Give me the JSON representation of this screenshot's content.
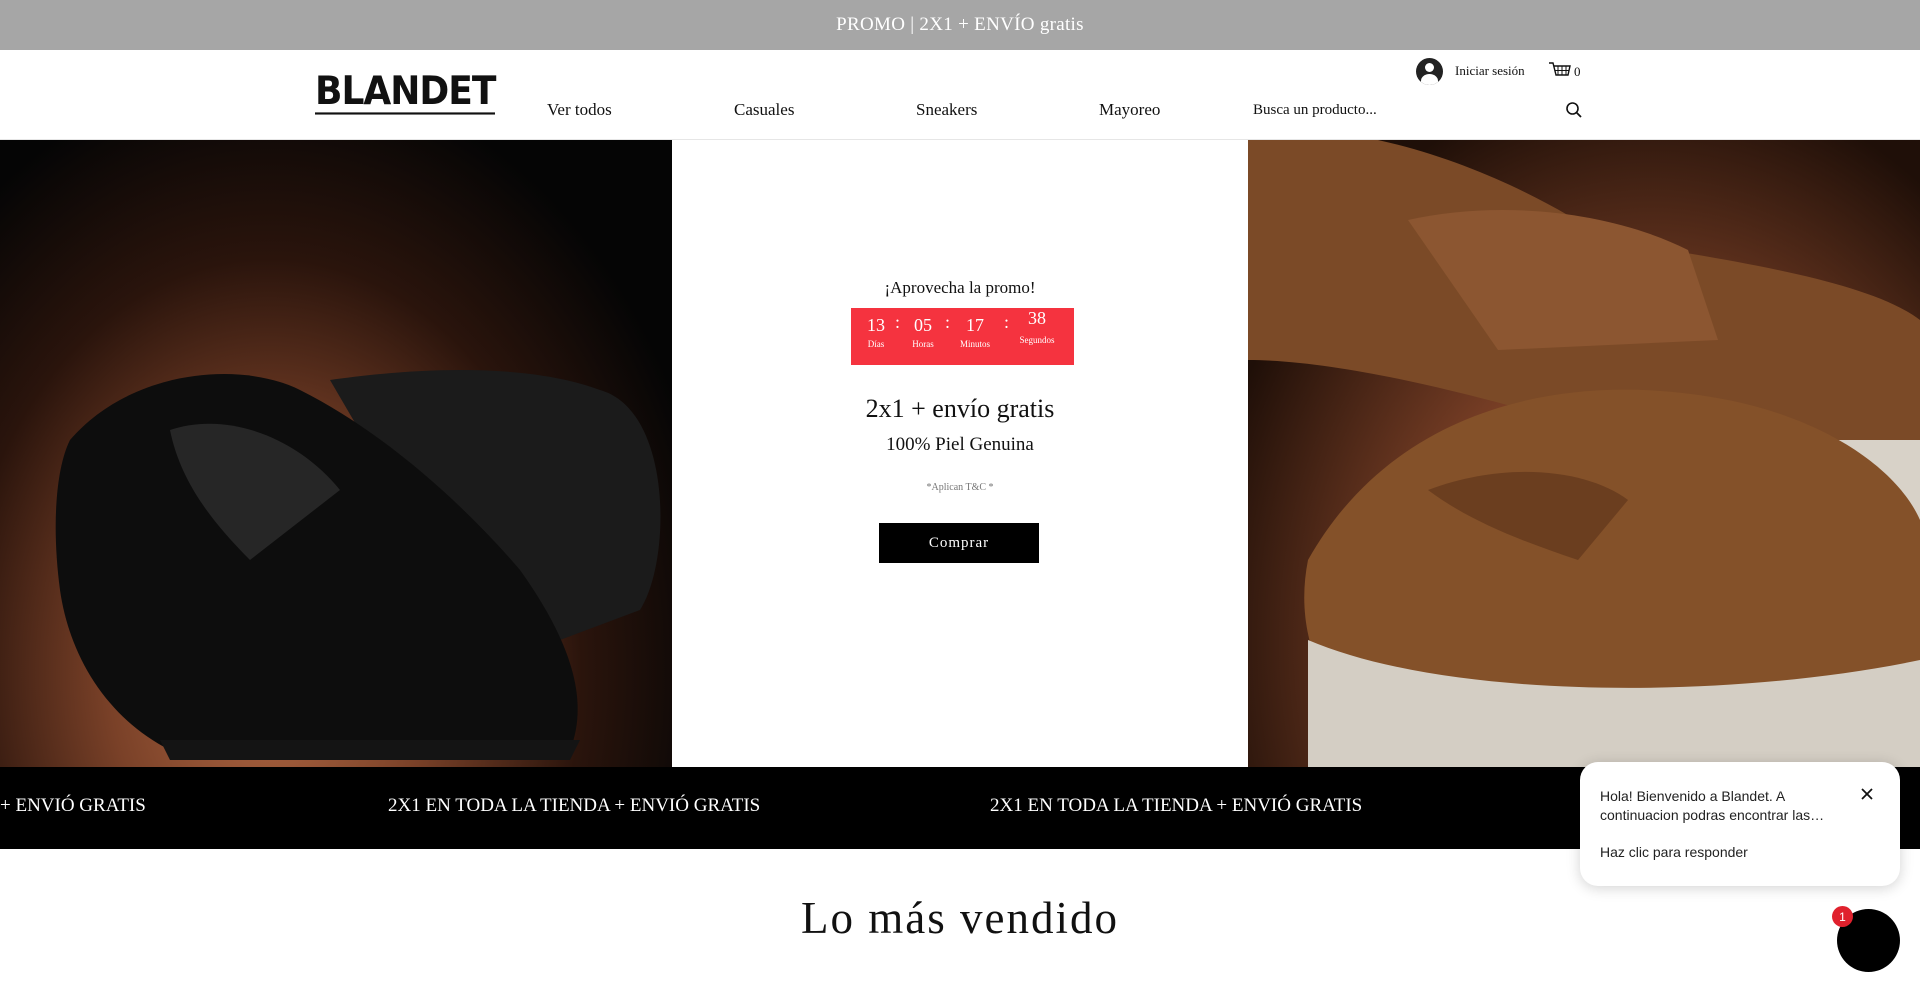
{
  "promo_bar": {
    "text": "PROMO | 2X1 + ENVÍO  gratis"
  },
  "header": {
    "logo": "BLANDET",
    "nav": [
      "Ver todos",
      "Casuales",
      "Sneakers",
      "Mayoreo"
    ],
    "search_placeholder": "Busca un producto...",
    "login_label": "Iniciar sesión",
    "cart_count": "0"
  },
  "hero": {
    "heading": "¡Aprovecha la promo!",
    "countdown": {
      "days": "13",
      "days_label": "Días",
      "hours": "05",
      "hours_label": "Horas",
      "minutes": "17",
      "minutes_label": "Minutos",
      "seconds": "38",
      "seconds_label": "Segundos"
    },
    "title": "2x1 + envío gratis",
    "subtitle": "100% Piel Genuina",
    "terms": "*Aplican T&C *",
    "button": "Comprar"
  },
  "ticker": {
    "items": [
      "+ ENVIÓ GRATIS ",
      "2X1 EN TODA LA TIENDA + ENVIÓ GRATIS ",
      "2X1 EN TODA LA TIENDA + ENVIÓ GRATIS "
    ]
  },
  "section": {
    "title": "Lo más vendido"
  },
  "chat": {
    "message": "Hola! Bienvenido a Blandet. A continuacion podras encontrar las…",
    "reply": "Haz clic para responder",
    "badge": "1"
  },
  "colors": {
    "promo_bar": "#a6a6a6",
    "countdown_bg": "#f5333f",
    "button_bg": "#000000",
    "ticker_bg": "#000000",
    "badge": "#e0212d"
  },
  "icons": [
    "avatar-icon",
    "cart-icon",
    "search-icon",
    "close-icon",
    "chat-icon"
  ]
}
